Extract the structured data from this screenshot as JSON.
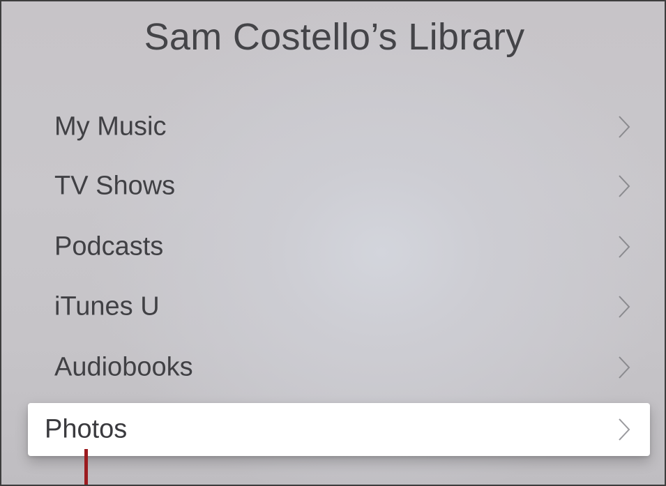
{
  "library": {
    "title": "Sam Costello’s Library"
  },
  "menu": {
    "items": [
      {
        "label": "My Music",
        "icon": "chevron-right-icon"
      },
      {
        "label": "TV Shows",
        "icon": "chevron-right-icon"
      },
      {
        "label": "Podcasts",
        "icon": "chevron-right-icon"
      },
      {
        "label": "iTunes U",
        "icon": "chevron-right-icon"
      },
      {
        "label": "Audiobooks",
        "icon": "chevron-right-icon"
      },
      {
        "label": "Photos",
        "icon": "chevron-right-icon",
        "selected": true
      }
    ]
  },
  "colors": {
    "text": "#404044",
    "selected_background": "#ffffff",
    "annotation_pointer": "#9b1b1f"
  }
}
